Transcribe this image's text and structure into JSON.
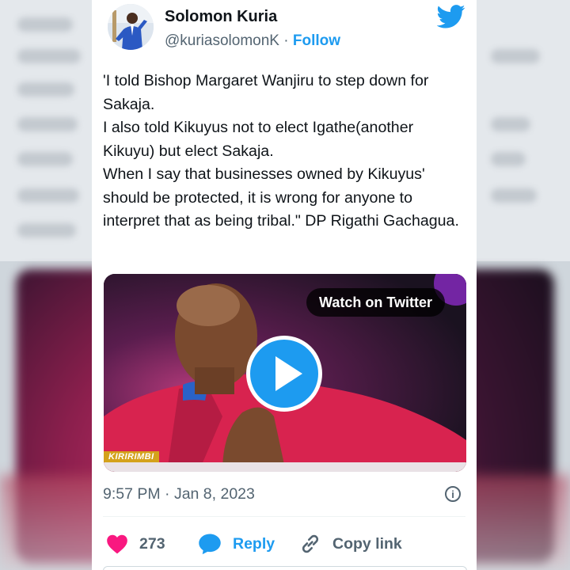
{
  "tweet": {
    "author_name": "Solomon Kuria",
    "handle": "@kuriasolomonK",
    "separator": "·",
    "follow_label": "Follow",
    "text_lines": [
      "'I told Bishop Margaret Wanjiru to step down for Sakaja.",
      "I also told Kikuyus not to elect Igathe(another Kikuyu) but elect Sakaja.",
      "When I say that businesses owned by Kikuyus' should be protected, it is wrong for anyone to interpret that as being tribal.\" DP Rigathi Gachagua."
    ],
    "timestamp": "9:57 PM · Jan 8, 2023",
    "info_glyph": "i"
  },
  "video": {
    "watch_label": "Watch on Twitter",
    "channel_tag": "KIRIRIMBI"
  },
  "actions": {
    "likes_count": "273",
    "reply_label": "Reply",
    "copy_link_label": "Copy link"
  },
  "colors": {
    "accent": "#1d9bf0",
    "like": "#f91880",
    "text": "#0f1419",
    "secondary": "#536471"
  },
  "icons": [
    "twitter-bird-icon",
    "play-icon",
    "info-icon",
    "heart-icon",
    "reply-bubble-icon",
    "link-icon"
  ]
}
